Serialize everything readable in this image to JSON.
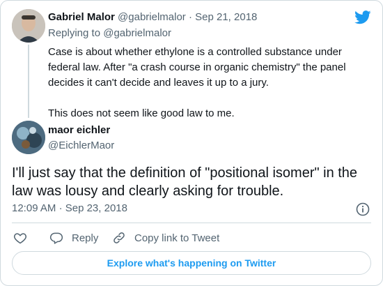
{
  "parent_tweet": {
    "author_name": "Gabriel Malor",
    "author_handle": "@gabrielmalor",
    "separator": "·",
    "date": "Sep 21, 2018",
    "replying_to_label": "Replying to",
    "replying_to_handle": "@gabrielmalor",
    "paragraphs": [
      "Case is about whether ethylone is a controlled substance under federal law. After \"a crash course in organic chemistry\" the panel decides it can't decide and leaves it up to a jury.",
      "This does not seem like good law to me."
    ]
  },
  "main_tweet": {
    "author_name": "maor eichler",
    "author_handle": "@EichlerMaor",
    "text": "I'll just say that the definition of \"positional isomer\" in the law was lousy and clearly asking for trouble.",
    "time": "12:09 AM",
    "separator": "·",
    "date": "Sep 23, 2018"
  },
  "actions": {
    "reply_label": "Reply",
    "copy_label": "Copy link to Tweet"
  },
  "explore_label": "Explore what's happening on Twitter",
  "colors": {
    "brand": "#1d9bf0",
    "muted": "#536471",
    "border": "#cfd9de"
  },
  "icons": [
    "twitter-bird-icon",
    "info-icon",
    "heart-icon",
    "reply-icon",
    "link-icon"
  ]
}
